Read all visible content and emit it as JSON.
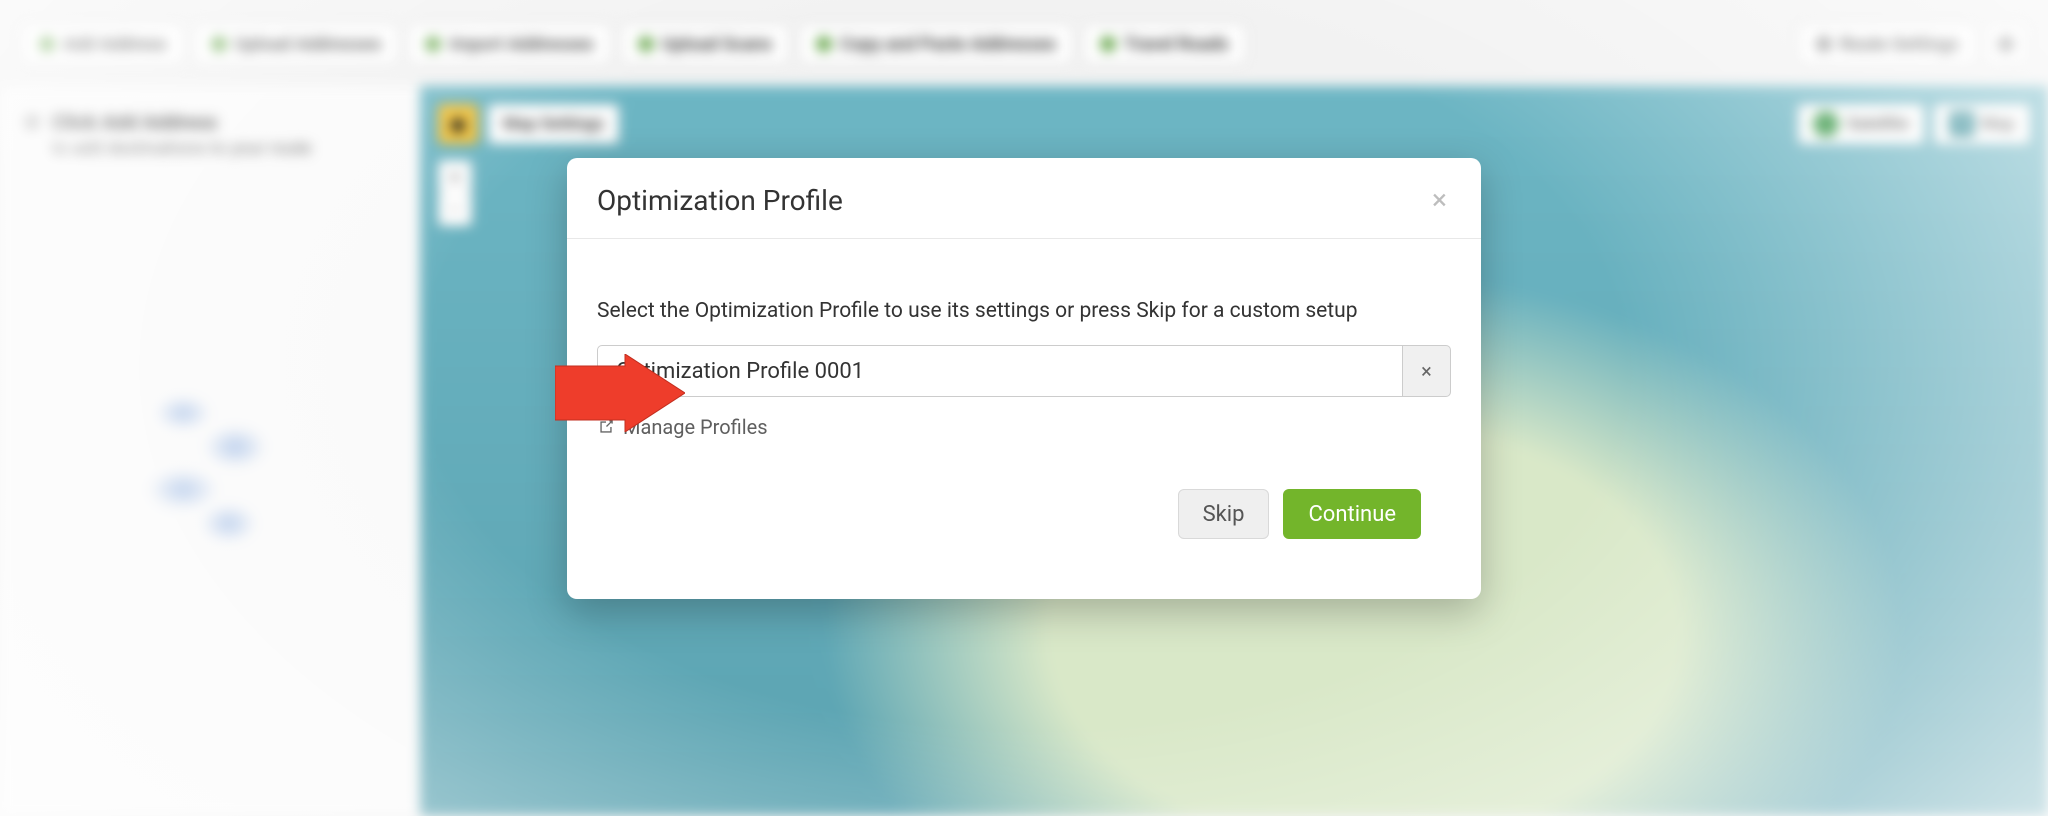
{
  "toolbar": {
    "add_address": "Add Address",
    "upload_addresses": "Upload Addresses",
    "import_addresses": "Import Addresses",
    "upload_scans": "Upload Scans",
    "copy_paste": "Copy and Paste Addresses",
    "travel_roads": "Travel Roads",
    "route_settings": "Route Settings"
  },
  "sidebar": {
    "title": "Click Add Address",
    "subtitle": "to add destinations to your route"
  },
  "map": {
    "map_settings": "Map Settings",
    "zoom_in": "+",
    "zoom_out": "−",
    "satellite": "Satellite",
    "num_badge": "1",
    "map_label": "Map"
  },
  "modal": {
    "title": "Optimization Profile",
    "description": "Select the Optimization Profile to use its settings or press Skip for a custom setup",
    "selected_profile": "Optimization Profile 0001",
    "clear": "×",
    "manage_profiles": "Manage Profiles",
    "skip": "Skip",
    "continue": "Continue",
    "close": "×"
  },
  "colors": {
    "accent_green": "#73b52b",
    "arrow_red": "#ee3d2b"
  }
}
